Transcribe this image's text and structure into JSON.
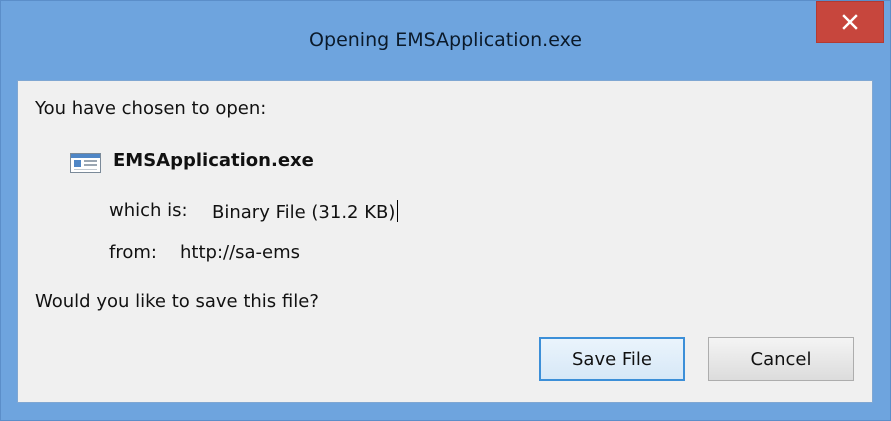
{
  "window": {
    "title": "Opening EMSApplication.exe",
    "close_icon": "close-icon"
  },
  "dialog": {
    "intro": "You have chosen to open:",
    "file_name": "EMSApplication.exe",
    "file_icon": "application-file-icon",
    "which_is_label": "which is:",
    "which_is_value": "Binary File (31.2 KB)",
    "from_label": "from:",
    "from_value": "http://sa-ems",
    "question": "Would you like to save this file?"
  },
  "buttons": {
    "save_label": "Save File",
    "cancel_label": "Cancel"
  },
  "colors": {
    "titlebar": "#6ea4de",
    "close_button": "#c7463d",
    "client_background": "#f0f0f0",
    "default_button_border": "#3c8fd8"
  }
}
